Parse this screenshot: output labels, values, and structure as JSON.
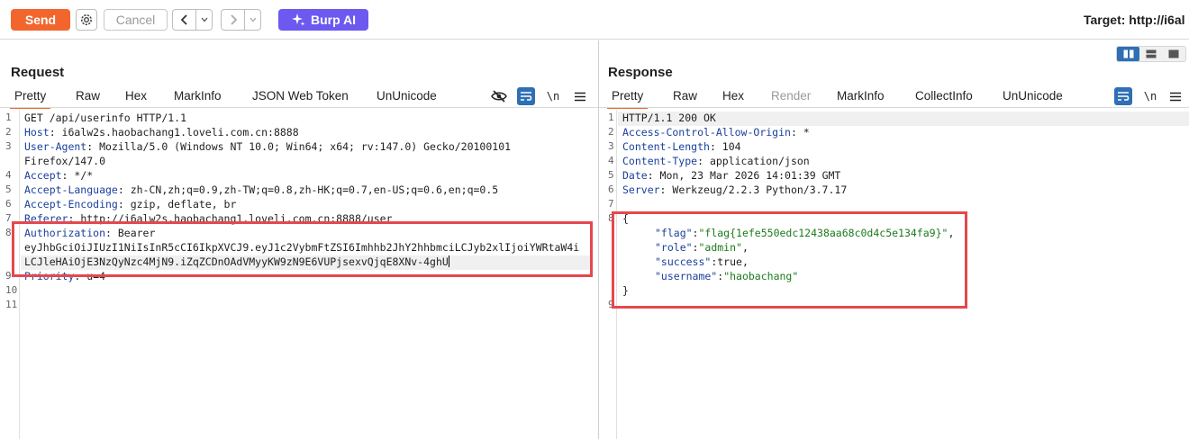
{
  "toolbar": {
    "send_label": "Send",
    "cancel_label": "Cancel",
    "burp_ai_label": "Burp AI",
    "target_text": "Target: http://i6al"
  },
  "request": {
    "title": "Request",
    "tabs": [
      "Pretty",
      "Raw",
      "Hex",
      "MarkInfo",
      "JSON Web Token",
      "UnUnicode"
    ],
    "line_numbers": [
      "1",
      "2",
      "3",
      "",
      "4",
      "5",
      "6",
      "7",
      "8",
      "",
      "",
      "9",
      "10",
      "11"
    ],
    "lines": [
      {
        "k": "",
        "v": "GET /api/userinfo HTTP/1.1"
      },
      {
        "k": "Host",
        "v": ": i6alw2s.haobachang1.loveli.com.cn:8888"
      },
      {
        "k": "User-Agent",
        "v": ": Mozilla/5.0 (Windows NT 10.0; Win64; x64; rv:147.0) Gecko/20100101"
      },
      {
        "k": "",
        "v": "Firefox/147.0"
      },
      {
        "k": "Accept",
        "v": ": */*"
      },
      {
        "k": "Accept-Language",
        "v": ": zh-CN,zh;q=0.9,zh-TW;q=0.8,zh-HK;q=0.7,en-US;q=0.6,en;q=0.5"
      },
      {
        "k": "Accept-Encoding",
        "v": ": gzip, deflate, br"
      },
      {
        "k": "Referer",
        "v": ": http://i6alw2s.haobachang1.loveli.com.cn:8888/user"
      },
      {
        "k": "Authorization",
        "v": ": Bearer"
      },
      {
        "k": "",
        "v": "eyJhbGciOiJIUzI1NiIsInR5cCI6IkpXVCJ9.eyJ1c2VybmFtZSI6Imhhb2JhY2hhbmciLCJyb2xlIjoiYWRtaW4i"
      },
      {
        "k": "",
        "v": "LCJleHAiOjE3NzQyNzc4MjN9.iZqZCDnOAdVMyyKW9zN9E6VUPjsexvQjqE8XNv-4ghU"
      },
      {
        "k": "Priority",
        "v": ": u=4"
      },
      {
        "k": "",
        "v": ""
      },
      {
        "k": "",
        "v": ""
      }
    ]
  },
  "response": {
    "title": "Response",
    "tabs": [
      "Pretty",
      "Raw",
      "Hex",
      "Render",
      "MarkInfo",
      "CollectInfo",
      "UnUnicode"
    ],
    "line_numbers": [
      "1",
      "2",
      "3",
      "4",
      "5",
      "6",
      "7",
      "8",
      "9"
    ],
    "headers": [
      {
        "k": "",
        "v": "HTTP/1.1 200 OK"
      },
      {
        "k": "Access-Control-Allow-Origin",
        "v": ": *"
      },
      {
        "k": "Content-Length",
        "v": ": 104"
      },
      {
        "k": "Content-Type",
        "v": ": application/json"
      },
      {
        "k": "Date",
        "v": ": Mon, 23 Mar 2026 14:01:39 GMT"
      },
      {
        "k": "Server",
        "v": ": Werkzeug/2.2.3 Python/3.7.17"
      }
    ],
    "json": {
      "open": "{",
      "close": "}",
      "fields": [
        {
          "k": "\"flag\"",
          "v": "\"flag{1efe550edc12438aa68c0d4c5e134fa9}\"",
          "sep": ":",
          "end": ","
        },
        {
          "k": "\"role\"",
          "v": "\"admin\"",
          "sep": ":",
          "end": ","
        },
        {
          "k": "\"success\"",
          "v": "true",
          "sep": ":",
          "end": ","
        },
        {
          "k": "\"username\"",
          "v": "\"haobachang\"",
          "sep": ":",
          "end": ""
        }
      ]
    }
  },
  "icons": {
    "settings": "gear-icon",
    "back": "chevron-left-icon",
    "forward": "chevron-right-icon",
    "dropdown": "chevron-down-icon",
    "ai": "sparkle-icon",
    "hide": "eye-slash-icon",
    "wrap": "wrap-icon",
    "newline": "newline-icon",
    "menu": "hamburger-icon"
  },
  "colors": {
    "send": "#f2662e",
    "burp_ai": "#6d58f0",
    "active_tab": "#f2662e",
    "highlight_box": "#e5484d",
    "header_key": "#1a3f9c",
    "json_string": "#1b7a1b"
  }
}
